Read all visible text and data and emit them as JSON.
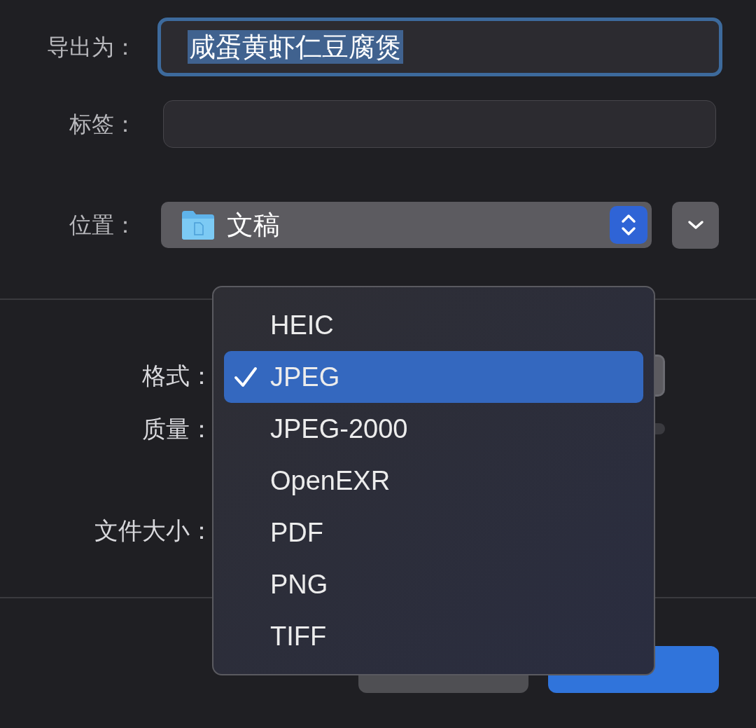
{
  "fields": [
    {
      "label": "导出为：",
      "value": "咸蛋黄虾仁豆腐煲",
      "focused": true
    },
    {
      "label": "标签：",
      "focused": false
    }
  ],
  "location": {
    "label": "位置：",
    "value": "文稿"
  },
  "options": [
    {
      "label": "格式："
    },
    {
      "label": "质量："
    },
    {
      "label": "文件大小："
    }
  ],
  "format_menu": [
    {
      "label": "HEIC",
      "selected": false
    },
    {
      "label": "JPEG",
      "selected": true
    },
    {
      "label": "JPEG-2000",
      "selected": false
    },
    {
      "label": "OpenEXR",
      "selected": false
    },
    {
      "label": "PDF",
      "selected": false
    },
    {
      "label": "PNG",
      "selected": false
    },
    {
      "label": "TIFF",
      "selected": false
    }
  ]
}
